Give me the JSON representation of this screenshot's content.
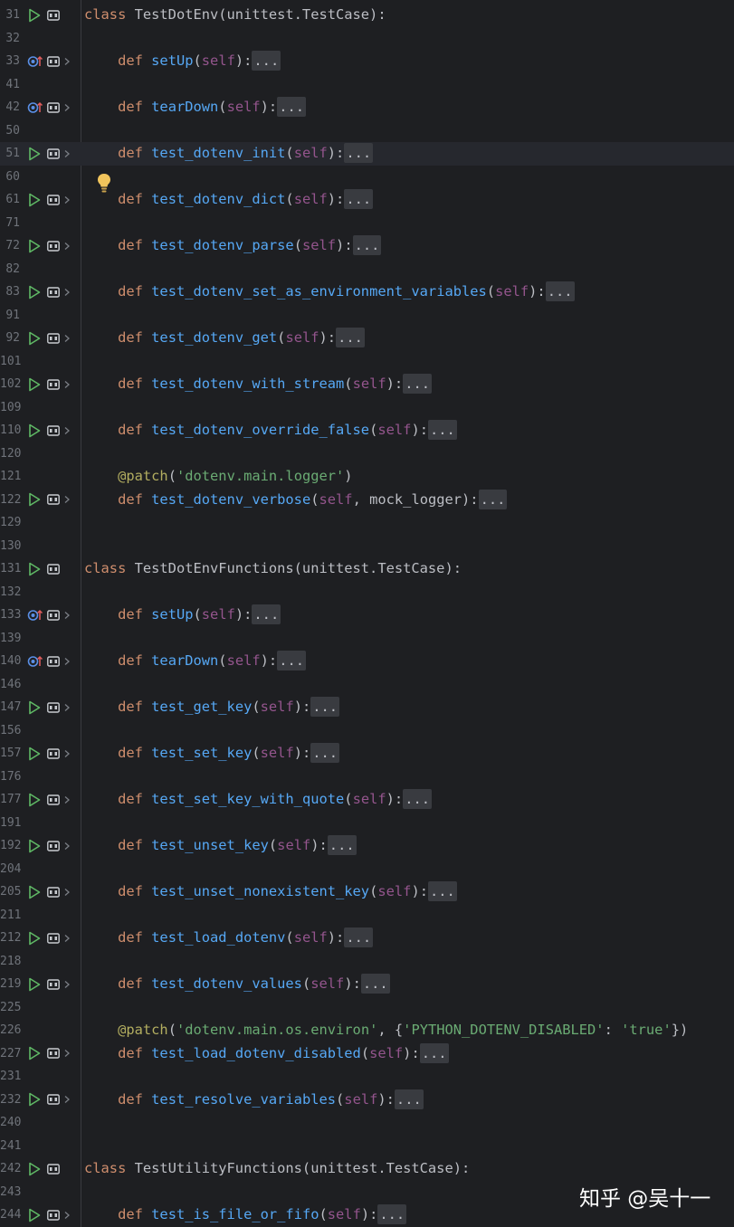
{
  "watermark": "知乎 @吴十一",
  "fold_placeholder": "...",
  "lines": [
    {
      "n": "31",
      "g": "run",
      "code": [
        [
          "kw",
          "class "
        ],
        [
          "",
          "TestDotEnv(unittest.TestCase):"
        ]
      ]
    },
    {
      "n": "32"
    },
    {
      "n": "33",
      "g": "ovr",
      "code": [
        [
          "",
          "    "
        ],
        [
          "kw",
          "def "
        ],
        [
          "fn",
          "setUp"
        ],
        [
          "",
          "("
        ],
        [
          "sf",
          "self"
        ],
        [
          "",
          "):"
        ],
        [
          "fold",
          "..."
        ]
      ]
    },
    {
      "n": "41"
    },
    {
      "n": "42",
      "g": "ovr",
      "code": [
        [
          "",
          "    "
        ],
        [
          "kw",
          "def "
        ],
        [
          "fn",
          "tearDown"
        ],
        [
          "",
          "("
        ],
        [
          "sf",
          "self"
        ],
        [
          "",
          "):"
        ],
        [
          "fold",
          "..."
        ]
      ]
    },
    {
      "n": "50"
    },
    {
      "n": "51",
      "g": "run",
      "cur": true,
      "code": [
        [
          "",
          "    "
        ],
        [
          "kw",
          "def "
        ],
        [
          "fn",
          "test_dotenv_init"
        ],
        [
          "",
          "("
        ],
        [
          "sf",
          "self"
        ],
        [
          "",
          "):"
        ],
        [
          "fold",
          "..."
        ]
      ]
    },
    {
      "n": "60"
    },
    {
      "n": "61",
      "g": "run",
      "code": [
        [
          "",
          "    "
        ],
        [
          "kw",
          "def "
        ],
        [
          "fn",
          "test_dotenv_dict"
        ],
        [
          "",
          "("
        ],
        [
          "sf",
          "self"
        ],
        [
          "",
          "):"
        ],
        [
          "fold",
          "..."
        ]
      ]
    },
    {
      "n": "71"
    },
    {
      "n": "72",
      "g": "run",
      "code": [
        [
          "",
          "    "
        ],
        [
          "kw",
          "def "
        ],
        [
          "fn",
          "test_dotenv_parse"
        ],
        [
          "",
          "("
        ],
        [
          "sf",
          "self"
        ],
        [
          "",
          "):"
        ],
        [
          "fold",
          "..."
        ]
      ]
    },
    {
      "n": "82"
    },
    {
      "n": "83",
      "g": "run",
      "code": [
        [
          "",
          "    "
        ],
        [
          "kw",
          "def "
        ],
        [
          "fn",
          "test_dotenv_set_as_environment_variables"
        ],
        [
          "",
          "("
        ],
        [
          "sf",
          "self"
        ],
        [
          "",
          "):"
        ],
        [
          "fold",
          "..."
        ]
      ]
    },
    {
      "n": "91"
    },
    {
      "n": "92",
      "g": "run",
      "code": [
        [
          "",
          "    "
        ],
        [
          "kw",
          "def "
        ],
        [
          "fn",
          "test_dotenv_get"
        ],
        [
          "",
          "("
        ],
        [
          "sf",
          "self"
        ],
        [
          "",
          "):"
        ],
        [
          "fold",
          "..."
        ]
      ]
    },
    {
      "n": "101"
    },
    {
      "n": "102",
      "g": "run",
      "code": [
        [
          "",
          "    "
        ],
        [
          "kw",
          "def "
        ],
        [
          "fn",
          "test_dotenv_with_stream"
        ],
        [
          "",
          "("
        ],
        [
          "sf",
          "self"
        ],
        [
          "",
          "):"
        ],
        [
          "fold",
          "..."
        ]
      ]
    },
    {
      "n": "109"
    },
    {
      "n": "110",
      "g": "run",
      "code": [
        [
          "",
          "    "
        ],
        [
          "kw",
          "def "
        ],
        [
          "fn",
          "test_dotenv_override_false"
        ],
        [
          "",
          "("
        ],
        [
          "sf",
          "self"
        ],
        [
          "",
          "):"
        ],
        [
          "fold",
          "..."
        ]
      ]
    },
    {
      "n": "120"
    },
    {
      "n": "121",
      "code": [
        [
          "",
          "    "
        ],
        [
          "dc",
          "@patch"
        ],
        [
          "",
          "("
        ],
        [
          "st",
          "'dotenv.main.logger'"
        ],
        [
          "",
          ")"
        ]
      ]
    },
    {
      "n": "122",
      "g": "run",
      "code": [
        [
          "",
          "    "
        ],
        [
          "kw",
          "def "
        ],
        [
          "fn",
          "test_dotenv_verbose"
        ],
        [
          "",
          "("
        ],
        [
          "sf",
          "self"
        ],
        [
          "",
          ", mock_logger):"
        ],
        [
          "fold",
          "..."
        ]
      ]
    },
    {
      "n": "129"
    },
    {
      "n": "130"
    },
    {
      "n": "131",
      "g": "run",
      "code": [
        [
          "kw",
          "class "
        ],
        [
          "",
          "TestDotEnvFunctions(unittest.TestCase):"
        ]
      ]
    },
    {
      "n": "132"
    },
    {
      "n": "133",
      "g": "ovr",
      "code": [
        [
          "",
          "    "
        ],
        [
          "kw",
          "def "
        ],
        [
          "fn",
          "setUp"
        ],
        [
          "",
          "("
        ],
        [
          "sf",
          "self"
        ],
        [
          "",
          "):"
        ],
        [
          "fold",
          "..."
        ]
      ]
    },
    {
      "n": "139"
    },
    {
      "n": "140",
      "g": "ovr",
      "code": [
        [
          "",
          "    "
        ],
        [
          "kw",
          "def "
        ],
        [
          "fn",
          "tearDown"
        ],
        [
          "",
          "("
        ],
        [
          "sf",
          "self"
        ],
        [
          "",
          "):"
        ],
        [
          "fold",
          "..."
        ]
      ]
    },
    {
      "n": "146"
    },
    {
      "n": "147",
      "g": "run",
      "code": [
        [
          "",
          "    "
        ],
        [
          "kw",
          "def "
        ],
        [
          "fn",
          "test_get_key"
        ],
        [
          "",
          "("
        ],
        [
          "sf",
          "self"
        ],
        [
          "",
          "):"
        ],
        [
          "fold",
          "..."
        ]
      ]
    },
    {
      "n": "156"
    },
    {
      "n": "157",
      "g": "run",
      "code": [
        [
          "",
          "    "
        ],
        [
          "kw",
          "def "
        ],
        [
          "fn",
          "test_set_key"
        ],
        [
          "",
          "("
        ],
        [
          "sf",
          "self"
        ],
        [
          "",
          "):"
        ],
        [
          "fold",
          "..."
        ]
      ]
    },
    {
      "n": "176"
    },
    {
      "n": "177",
      "g": "run",
      "code": [
        [
          "",
          "    "
        ],
        [
          "kw",
          "def "
        ],
        [
          "fn",
          "test_set_key_with_quote"
        ],
        [
          "",
          "("
        ],
        [
          "sf",
          "self"
        ],
        [
          "",
          "):"
        ],
        [
          "fold",
          "..."
        ]
      ]
    },
    {
      "n": "191"
    },
    {
      "n": "192",
      "g": "run",
      "code": [
        [
          "",
          "    "
        ],
        [
          "kw",
          "def "
        ],
        [
          "fn",
          "test_unset_key"
        ],
        [
          "",
          "("
        ],
        [
          "sf",
          "self"
        ],
        [
          "",
          "):"
        ],
        [
          "fold",
          "..."
        ]
      ]
    },
    {
      "n": "204"
    },
    {
      "n": "205",
      "g": "run",
      "code": [
        [
          "",
          "    "
        ],
        [
          "kw",
          "def "
        ],
        [
          "fn",
          "test_unset_nonexistent_key"
        ],
        [
          "",
          "("
        ],
        [
          "sf",
          "self"
        ],
        [
          "",
          "):"
        ],
        [
          "fold",
          "..."
        ]
      ]
    },
    {
      "n": "211"
    },
    {
      "n": "212",
      "g": "run",
      "code": [
        [
          "",
          "    "
        ],
        [
          "kw",
          "def "
        ],
        [
          "fn",
          "test_load_dotenv"
        ],
        [
          "",
          "("
        ],
        [
          "sf",
          "self"
        ],
        [
          "",
          "):"
        ],
        [
          "fold",
          "..."
        ]
      ]
    },
    {
      "n": "218"
    },
    {
      "n": "219",
      "g": "run",
      "code": [
        [
          "",
          "    "
        ],
        [
          "kw",
          "def "
        ],
        [
          "fn",
          "test_dotenv_values"
        ],
        [
          "",
          "("
        ],
        [
          "sf",
          "self"
        ],
        [
          "",
          "):"
        ],
        [
          "fold",
          "..."
        ]
      ]
    },
    {
      "n": "225"
    },
    {
      "n": "226",
      "code": [
        [
          "",
          "    "
        ],
        [
          "dc",
          "@patch"
        ],
        [
          "",
          "("
        ],
        [
          "st",
          "'dotenv.main.os.environ'"
        ],
        [
          "",
          ", {"
        ],
        [
          "st",
          "'PYTHON_DOTENV_DISABLED'"
        ],
        [
          "",
          ": "
        ],
        [
          "st",
          "'true'"
        ],
        [
          "",
          "})"
        ]
      ]
    },
    {
      "n": "227",
      "g": "run",
      "code": [
        [
          "",
          "    "
        ],
        [
          "kw",
          "def "
        ],
        [
          "fn",
          "test_load_dotenv_disabled"
        ],
        [
          "",
          "("
        ],
        [
          "sf",
          "self"
        ],
        [
          "",
          "):"
        ],
        [
          "fold",
          "..."
        ]
      ]
    },
    {
      "n": "231"
    },
    {
      "n": "232",
      "g": "run",
      "code": [
        [
          "",
          "    "
        ],
        [
          "kw",
          "def "
        ],
        [
          "fn",
          "test_resolve_variables"
        ],
        [
          "",
          "("
        ],
        [
          "sf",
          "self"
        ],
        [
          "",
          "):"
        ],
        [
          "fold",
          "..."
        ]
      ]
    },
    {
      "n": "240"
    },
    {
      "n": "241"
    },
    {
      "n": "242",
      "g": "run",
      "code": [
        [
          "kw",
          "class "
        ],
        [
          "",
          "TestUtilityFunctions(unittest.TestCase):"
        ]
      ]
    },
    {
      "n": "243"
    },
    {
      "n": "244",
      "g": "run",
      "code": [
        [
          "",
          "    "
        ],
        [
          "kw",
          "def "
        ],
        [
          "fn",
          "test_is_file_or_fifo"
        ],
        [
          "",
          "("
        ],
        [
          "sf",
          "self"
        ],
        [
          "",
          "):"
        ],
        [
          "fold",
          "..."
        ]
      ]
    }
  ]
}
